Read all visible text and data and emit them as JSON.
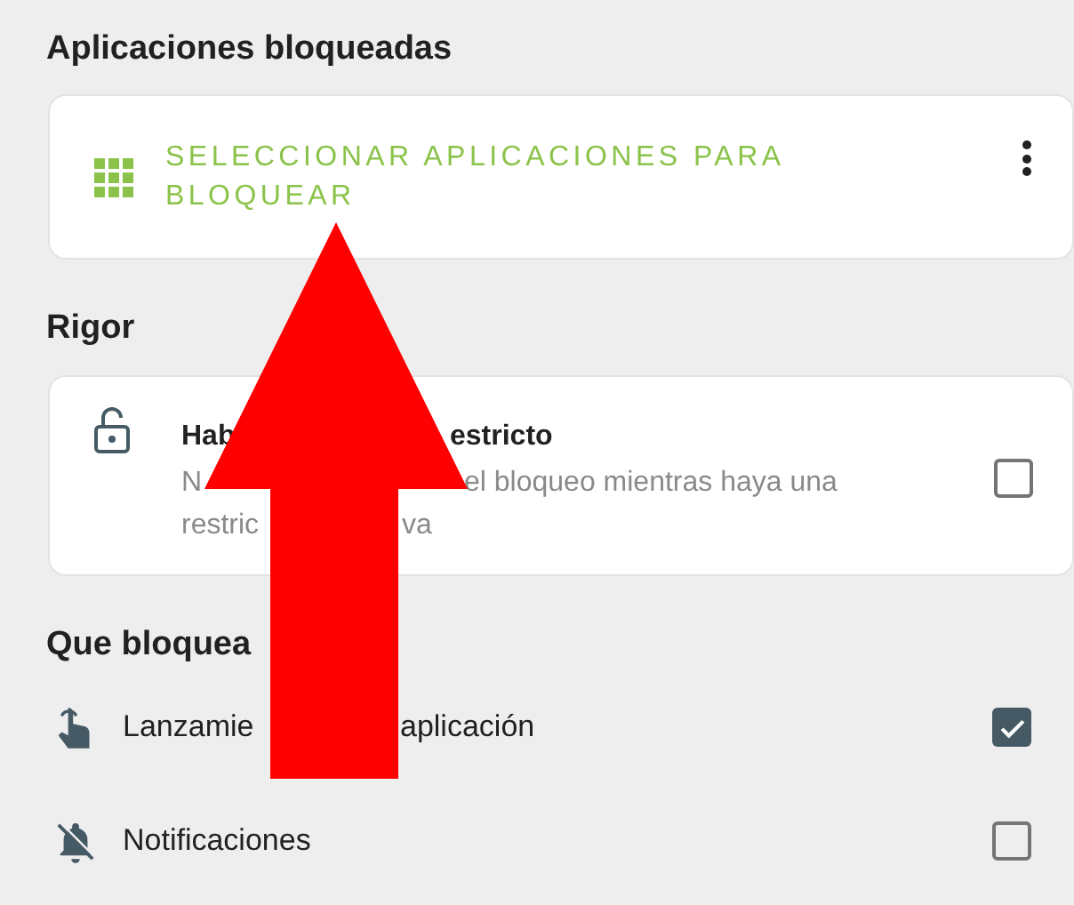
{
  "sections": [
    {
      "kind": "action",
      "heading": "Aplicaciones bloqueadas",
      "card": {
        "label": "SELECCIONAR APLICACIONES PARA BLOQUEAR"
      }
    },
    {
      "kind": "toggle",
      "heading": "Rigor",
      "card": {
        "title": [
          "Hab",
          "estricto"
        ],
        "subtitle_lines": [
          [
            "N",
            "el bloqueo mientras haya una"
          ],
          [
            "restric",
            "va"
          ]
        ],
        "checked": false
      }
    },
    {
      "kind": "list",
      "heading": "Que bloquea",
      "rows": [
        {
          "kind": "launch",
          "label": [
            "Lanzamie",
            "aplicación"
          ],
          "checked": true
        },
        {
          "kind": "notifications",
          "label": [
            "Notificaciones"
          ],
          "checked": false
        }
      ]
    }
  ]
}
